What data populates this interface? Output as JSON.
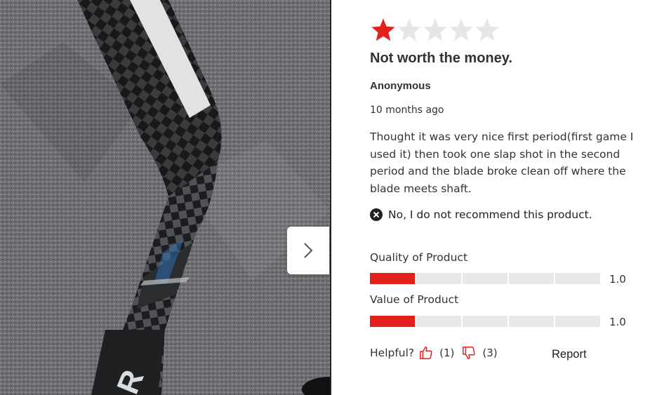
{
  "gallery": {
    "image_alt": "Broken hockey stick blade on carpet",
    "next_icon": "chevron-right-icon"
  },
  "review": {
    "rating": 1,
    "rating_max": 5,
    "title": "Not worth the money.",
    "author": "Anonymous",
    "date": "10 months ago",
    "body": "Thought it was very nice first period(first game I used it) then took one slap shot in the second period and the blade broke clean off where the blade meets shaft.",
    "recommend_text": "No, I do not recommend this product.",
    "recommend_icon": "x-circle-icon"
  },
  "metrics": [
    {
      "label": "Quality of Product",
      "value": 1.0,
      "value_text": "1.0",
      "max": 5
    },
    {
      "label": "Value of Product",
      "value": 1.0,
      "value_text": "1.0",
      "max": 5
    }
  ],
  "helpful": {
    "label": "Helpful?",
    "up_count": "(1)",
    "down_count": "(3)",
    "report_label": "Report"
  },
  "colors": {
    "accent": "#e3211c",
    "star_empty": "#e6e6e6",
    "bar_empty": "#e8e8e8"
  }
}
